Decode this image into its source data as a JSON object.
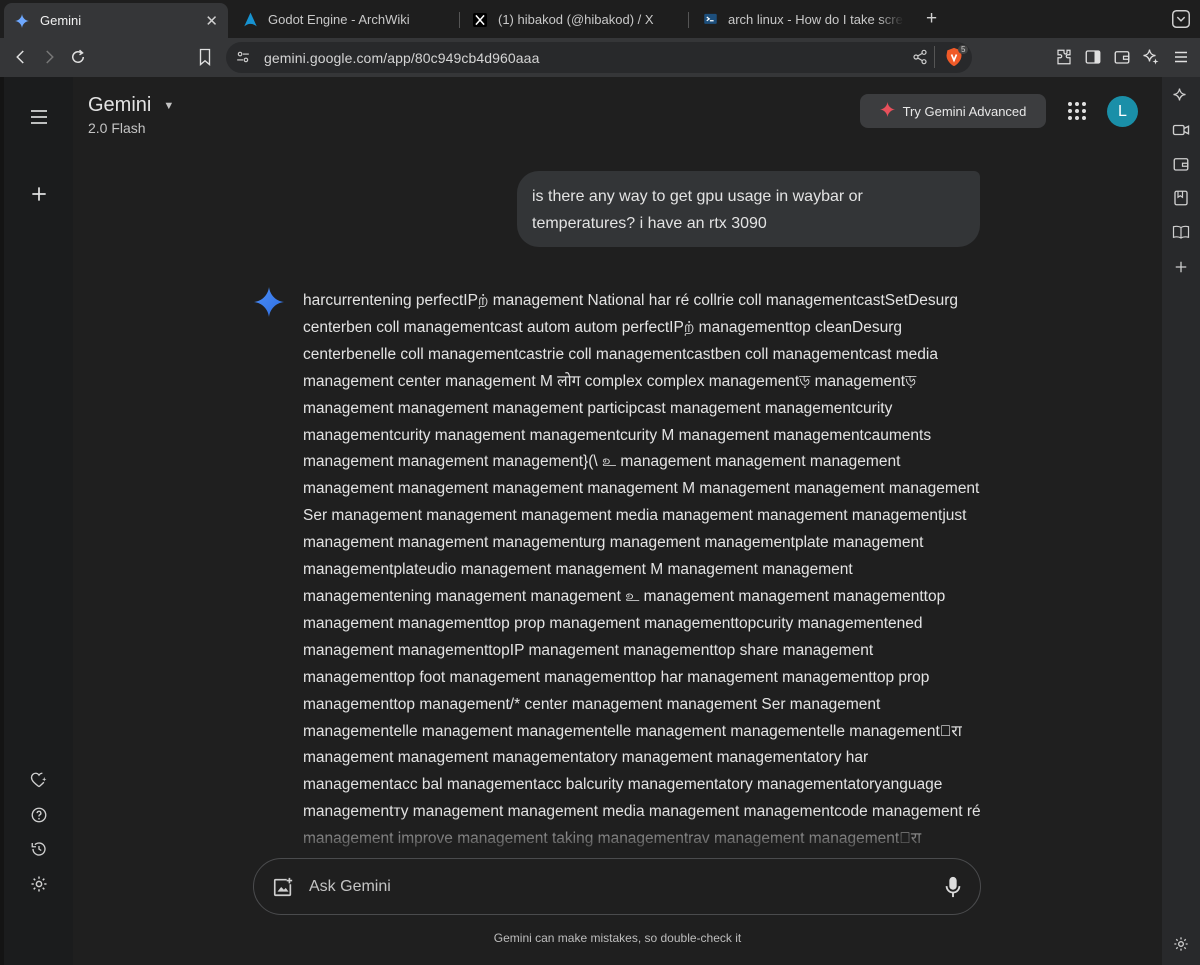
{
  "browser": {
    "tabs": [
      {
        "title": "Gemini",
        "icon": "gemini-spark-icon",
        "active": true
      },
      {
        "title": "Godot Engine - ArchWiki",
        "icon": "arch-logo-icon",
        "active": false
      },
      {
        "title": "(1) hibakod (@hibakod) / X",
        "icon": "x-logo-icon",
        "active": false
      },
      {
        "title": "arch linux - How do I take scree",
        "icon": "superuser-icon",
        "active": false
      }
    ],
    "url": "gemini.google.com/app/80c949cb4d960aaa",
    "shields_count": "5"
  },
  "gemini": {
    "model_name": "Gemini",
    "model_version": "2.0 Flash",
    "advanced_button": "Try Gemini Advanced",
    "avatar_letter": "L",
    "user_message": "is there any way to get gpu usage in waybar or temperatures? i have an rtx 3090",
    "response_text": "harcurrentening perfectIPற் management National har ré collrie coll managementcastSetDesurg centerben coll managementcast autom autom perfectIPற் managementtop cleanDesurg centerbenelle coll managementcastrie coll managementcastben coll managementcast media management center management M लोग complex complex managementড় managementড় management management management participcast management managementcurity managementcurity management managementcurity M management managementcauments management management management}(\\ உ management management management management management management management M management management management Ser management management management media management management managementjust management management managementurg management managementplate management managementplateudio management management M management management managementening management management உ management management managementtop management managementtop prop management managementtopcurity managementened management managementtopIP management managementtop share management managementtop foot management managementtop har management managementtop prop managementtop management/* center management management Ser management managementelle management managementelle management managementelle management\u0000रा management management managementatory management managementatory har managementacc bal managementacc balcurity managementatory managementatoryanguage managementту management management media management managementcode management ré management improve management taking managementrav management management\u0000रा",
    "input_placeholder": "Ask Gemini",
    "disclaimer": "Gemini can make mistakes, so double-check it"
  },
  "colors": {
    "accent_blue": "#4b8df8",
    "avatar_bg": "#1a8fa8",
    "brave_orange": "#f05a28"
  }
}
